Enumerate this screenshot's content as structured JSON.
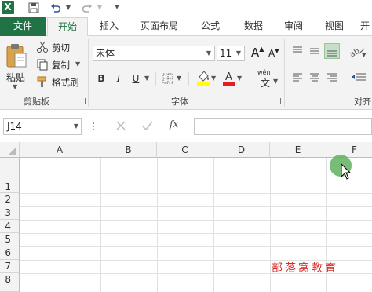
{
  "app": {
    "logo": "X",
    "qat": {
      "save_icon": "save-icon",
      "undo_icon": "undo-icon",
      "redo_icon": "redo-icon"
    }
  },
  "tabs": [
    "文件",
    "开始",
    "插入",
    "页面布局",
    "公式",
    "数据",
    "审阅",
    "视图",
    "开"
  ],
  "clipboard": {
    "paste": "粘贴",
    "cut": "剪切",
    "copy": "复制",
    "format_painter": "格式刷",
    "group_label": "剪贴板"
  },
  "font": {
    "name": "宋体",
    "size": "11",
    "grow": "A",
    "shrink": "A",
    "bold": "B",
    "italic": "I",
    "underline": "U",
    "phonetic": "wén",
    "phonetic_char": "文",
    "group_label": "字体"
  },
  "alignment": {
    "group_label": "对齐"
  },
  "formula_bar": {
    "name_box": "J14",
    "fx": "fx",
    "formula": ""
  },
  "columns": [
    "A",
    "B",
    "C",
    "D",
    "E",
    "F"
  ],
  "rows": [
    "1",
    "2",
    "3",
    "4",
    "5",
    "6",
    "7",
    "8"
  ],
  "watermark": "部落窝教育",
  "colors": {
    "excel_green": "#217346",
    "font_color": "#e02020",
    "fill_color": "#ffff00"
  }
}
